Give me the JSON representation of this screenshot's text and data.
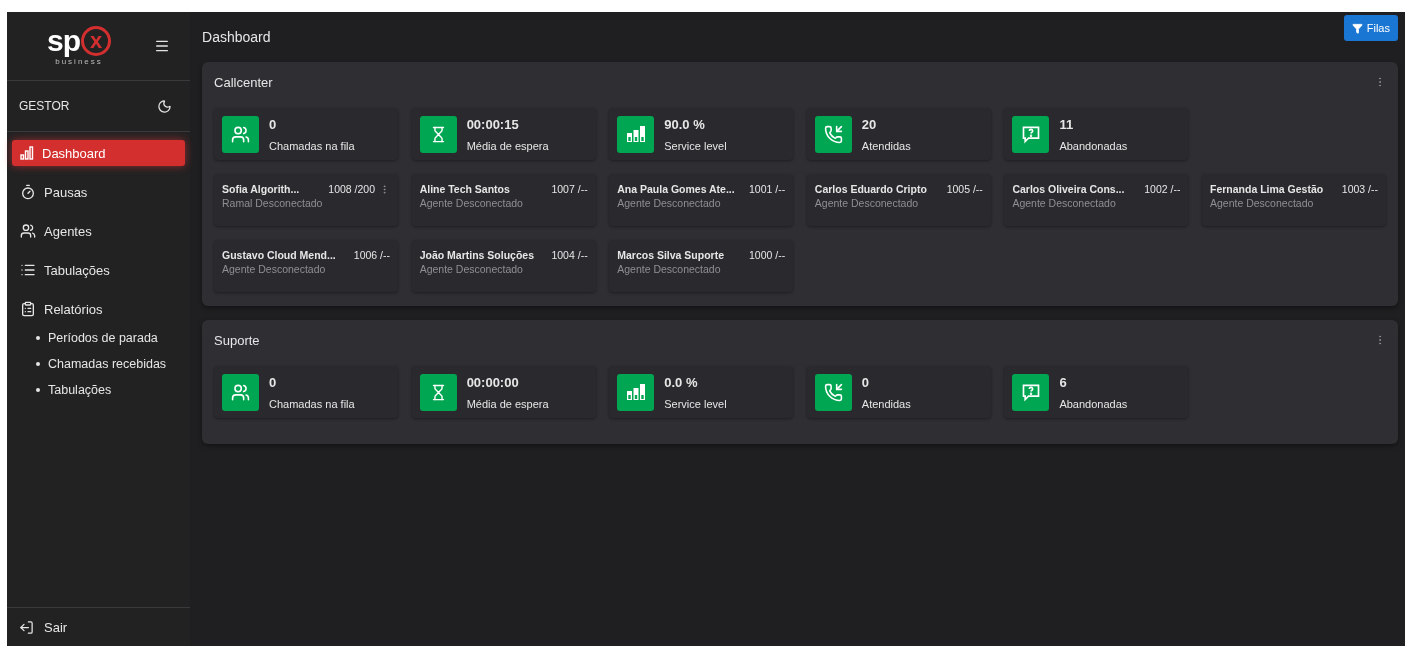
{
  "logo": {
    "text": "sp",
    "mark": "x",
    "tagline": "business"
  },
  "sidebar": {
    "role": "GESTOR",
    "items": [
      {
        "kind": "dashboard",
        "label": "Dashboard",
        "selected": true
      },
      {
        "kind": "pauses",
        "label": "Pausas",
        "selected": false
      },
      {
        "kind": "agents",
        "label": "Agentes",
        "selected": false
      },
      {
        "kind": "list",
        "label": "Tabulações",
        "selected": false
      },
      {
        "kind": "reports",
        "label": "Relatórios",
        "selected": false,
        "expanded": true,
        "children": [
          {
            "label": "Períodos de parada",
            "selected": false
          },
          {
            "label": "Chamadas recebidas",
            "selected": false
          },
          {
            "label": "Tabulações",
            "selected": false
          }
        ]
      }
    ],
    "logout": "Sair"
  },
  "header": {
    "title": "Dashboard",
    "button": "Filas"
  },
  "queues": [
    {
      "name": "Callcenter",
      "stats": [
        {
          "kind": "queue",
          "value": "0",
          "label": "Chamadas na fila"
        },
        {
          "kind": "wait",
          "value": "00:00:15",
          "label": "Média de espera"
        },
        {
          "kind": "service",
          "value": "90.0 %",
          "label": "Service level"
        },
        {
          "kind": "answered",
          "value": "20",
          "label": "Atendidas"
        },
        {
          "kind": "abandoned",
          "value": "11",
          "label": "Abandonadas"
        }
      ],
      "agents": [
        {
          "name": "Sofia Algorith...",
          "ext": "1008 /200",
          "status": "Ramal Desconectado",
          "menu": true
        },
        {
          "name": "Aline Tech Santos",
          "ext": "1007 /--",
          "status": "Agente Desconectado",
          "menu": false
        },
        {
          "name": "Ana Paula Gomes Ate...",
          "ext": "1001 /--",
          "status": "Agente Desconectado",
          "menu": false
        },
        {
          "name": "Carlos Eduardo Cripto",
          "ext": "1005 /--",
          "status": "Agente Desconectado",
          "menu": false
        },
        {
          "name": "Carlos Oliveira Cons...",
          "ext": "1002 /--",
          "status": "Agente Desconectado",
          "menu": false
        },
        {
          "name": "Fernanda Lima Gestão",
          "ext": "1003 /--",
          "status": "Agente Desconectado",
          "menu": false
        },
        {
          "name": "Gustavo Cloud Mend...",
          "ext": "1006 /--",
          "status": "Agente Desconectado",
          "menu": false
        },
        {
          "name": "João Martins Soluções",
          "ext": "1004 /--",
          "status": "Agente Desconectado",
          "menu": false
        },
        {
          "name": "Marcos Silva Suporte",
          "ext": "1000 /--",
          "status": "Agente Desconectado",
          "menu": false
        }
      ]
    },
    {
      "name": "Suporte",
      "stats": [
        {
          "kind": "queue",
          "value": "0",
          "label": "Chamadas na fila"
        },
        {
          "kind": "wait",
          "value": "00:00:00",
          "label": "Média de espera"
        },
        {
          "kind": "service",
          "value": "0.0 %",
          "label": "Service level"
        },
        {
          "kind": "answered",
          "value": "0",
          "label": "Atendidas"
        },
        {
          "kind": "abandoned",
          "value": "6",
          "label": "Abandonadas"
        }
      ]
    }
  ]
}
